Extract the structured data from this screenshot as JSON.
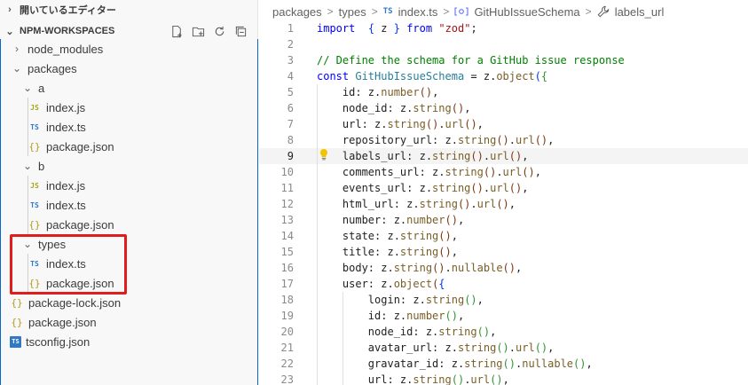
{
  "sidebar": {
    "open_editors_label": "開いているエディター",
    "workspace_label": "NPM-WORKSPACES",
    "tree": [
      {
        "label": "node_modules",
        "kind": "folder",
        "expanded": false,
        "depth": 0
      },
      {
        "label": "packages",
        "kind": "folder",
        "expanded": true,
        "depth": 0
      },
      {
        "label": "a",
        "kind": "folder",
        "expanded": true,
        "depth": 1
      },
      {
        "label": "index.js",
        "kind": "js",
        "depth": 2
      },
      {
        "label": "index.ts",
        "kind": "ts",
        "depth": 2
      },
      {
        "label": "package.json",
        "kind": "json",
        "depth": 2
      },
      {
        "label": "b",
        "kind": "folder",
        "expanded": true,
        "depth": 1
      },
      {
        "label": "index.js",
        "kind": "js",
        "depth": 2
      },
      {
        "label": "index.ts",
        "kind": "ts",
        "depth": 2
      },
      {
        "label": "package.json",
        "kind": "json",
        "depth": 2
      },
      {
        "label": "types",
        "kind": "folder",
        "expanded": true,
        "depth": 1
      },
      {
        "label": "index.ts",
        "kind": "ts",
        "depth": 2
      },
      {
        "label": "package.json",
        "kind": "json",
        "depth": 2
      },
      {
        "label": "package-lock.json",
        "kind": "json",
        "depth": 0
      },
      {
        "label": "package.json",
        "kind": "json",
        "depth": 0
      },
      {
        "label": "tsconfig.json",
        "kind": "tsconfig",
        "depth": 0
      }
    ],
    "icons": {
      "js": "JS",
      "ts": "TS",
      "json": "{}",
      "tsconfig": "TS"
    }
  },
  "breadcrumb": {
    "items": [
      "packages",
      "types",
      "index.ts",
      "GitHubIssueSchema",
      "labels_url"
    ],
    "separator": ">"
  },
  "editor": {
    "active_line": 9,
    "lines": [
      {
        "n": "1",
        "tokens": [
          [
            "kw",
            "import"
          ],
          [
            "",
            "  "
          ],
          [
            "br1",
            "{"
          ],
          [
            "",
            " z "
          ],
          [
            "br1",
            "}"
          ],
          [
            "",
            " "
          ],
          [
            "kw",
            "from"
          ],
          [
            "",
            " "
          ],
          [
            "str",
            "\"zod\""
          ],
          [
            "",
            ";"
          ]
        ]
      },
      {
        "n": "2",
        "tokens": []
      },
      {
        "n": "3",
        "tokens": [
          [
            "cm",
            "// Define the schema for a GitHub issue response"
          ]
        ]
      },
      {
        "n": "4",
        "tokens": [
          [
            "kw",
            "const"
          ],
          [
            "",
            " "
          ],
          [
            "type",
            "GitHubIssueSchema"
          ],
          [
            "",
            " = z."
          ],
          [
            "fn",
            "object"
          ],
          [
            "br1",
            "("
          ],
          [
            "br2",
            "{"
          ]
        ]
      },
      {
        "n": "5",
        "tokens": [
          [
            "",
            "    id: z."
          ],
          [
            "fn",
            "number"
          ],
          [
            "br3",
            "()"
          ],
          [
            "",
            ","
          ]
        ]
      },
      {
        "n": "6",
        "tokens": [
          [
            "",
            "    node_id: z."
          ],
          [
            "fn",
            "string"
          ],
          [
            "br3",
            "()"
          ],
          [
            "",
            ","
          ]
        ]
      },
      {
        "n": "7",
        "tokens": [
          [
            "",
            "    url: z."
          ],
          [
            "fn",
            "string"
          ],
          [
            "br3",
            "()"
          ],
          [
            "",
            "."
          ],
          [
            "fn",
            "url"
          ],
          [
            "br3",
            "()"
          ],
          [
            "",
            ","
          ]
        ]
      },
      {
        "n": "8",
        "tokens": [
          [
            "",
            "    repository_url: z."
          ],
          [
            "fn",
            "string"
          ],
          [
            "br3",
            "()"
          ],
          [
            "",
            "."
          ],
          [
            "fn",
            "url"
          ],
          [
            "br3",
            "()"
          ],
          [
            "",
            ","
          ]
        ]
      },
      {
        "n": "9",
        "tokens": [
          [
            "",
            "    labels_url: z."
          ],
          [
            "fn",
            "string"
          ],
          [
            "br3",
            "()"
          ],
          [
            "",
            "."
          ],
          [
            "fn",
            "url"
          ],
          [
            "br3",
            "()"
          ],
          [
            "",
            ","
          ]
        ]
      },
      {
        "n": "10",
        "tokens": [
          [
            "",
            "    comments_url: z."
          ],
          [
            "fn",
            "string"
          ],
          [
            "br3",
            "()"
          ],
          [
            "",
            "."
          ],
          [
            "fn",
            "url"
          ],
          [
            "br3",
            "()"
          ],
          [
            "",
            ","
          ]
        ]
      },
      {
        "n": "11",
        "tokens": [
          [
            "",
            "    events_url: z."
          ],
          [
            "fn",
            "string"
          ],
          [
            "br3",
            "()"
          ],
          [
            "",
            "."
          ],
          [
            "fn",
            "url"
          ],
          [
            "br3",
            "()"
          ],
          [
            "",
            ","
          ]
        ]
      },
      {
        "n": "12",
        "tokens": [
          [
            "",
            "    html_url: z."
          ],
          [
            "fn",
            "string"
          ],
          [
            "br3",
            "()"
          ],
          [
            "",
            "."
          ],
          [
            "fn",
            "url"
          ],
          [
            "br3",
            "()"
          ],
          [
            "",
            ","
          ]
        ]
      },
      {
        "n": "13",
        "tokens": [
          [
            "",
            "    number: z."
          ],
          [
            "fn",
            "number"
          ],
          [
            "br3",
            "()"
          ],
          [
            "",
            ","
          ]
        ]
      },
      {
        "n": "14",
        "tokens": [
          [
            "",
            "    state: z."
          ],
          [
            "fn",
            "string"
          ],
          [
            "br3",
            "()"
          ],
          [
            "",
            ","
          ]
        ]
      },
      {
        "n": "15",
        "tokens": [
          [
            "",
            "    title: z."
          ],
          [
            "fn",
            "string"
          ],
          [
            "br3",
            "()"
          ],
          [
            "",
            ","
          ]
        ]
      },
      {
        "n": "16",
        "tokens": [
          [
            "",
            "    body: z."
          ],
          [
            "fn",
            "string"
          ],
          [
            "br3",
            "()"
          ],
          [
            "",
            "."
          ],
          [
            "fn",
            "nullable"
          ],
          [
            "br3",
            "()"
          ],
          [
            "",
            ","
          ]
        ]
      },
      {
        "n": "17",
        "tokens": [
          [
            "",
            "    user: z."
          ],
          [
            "fn",
            "object"
          ],
          [
            "br3",
            "("
          ],
          [
            "br1",
            "{"
          ]
        ]
      },
      {
        "n": "18",
        "tokens": [
          [
            "",
            "        login: z."
          ],
          [
            "fn",
            "string"
          ],
          [
            "br2",
            "()"
          ],
          [
            "",
            ","
          ]
        ]
      },
      {
        "n": "19",
        "tokens": [
          [
            "",
            "        id: z."
          ],
          [
            "fn",
            "number"
          ],
          [
            "br2",
            "()"
          ],
          [
            "",
            ","
          ]
        ]
      },
      {
        "n": "20",
        "tokens": [
          [
            "",
            "        node_id: z."
          ],
          [
            "fn",
            "string"
          ],
          [
            "br2",
            "()"
          ],
          [
            "",
            ","
          ]
        ]
      },
      {
        "n": "21",
        "tokens": [
          [
            "",
            "        avatar_url: z."
          ],
          [
            "fn",
            "string"
          ],
          [
            "br2",
            "()"
          ],
          [
            "",
            "."
          ],
          [
            "fn",
            "url"
          ],
          [
            "br2",
            "()"
          ],
          [
            "",
            ","
          ]
        ]
      },
      {
        "n": "22",
        "tokens": [
          [
            "",
            "        gravatar_id: z."
          ],
          [
            "fn",
            "string"
          ],
          [
            "br2",
            "()"
          ],
          [
            "",
            "."
          ],
          [
            "fn",
            "nullable"
          ],
          [
            "br2",
            "()"
          ],
          [
            "",
            ","
          ]
        ]
      },
      {
        "n": "23",
        "tokens": [
          [
            "",
            "        url: z."
          ],
          [
            "fn",
            "string"
          ],
          [
            "br2",
            "()"
          ],
          [
            "",
            "."
          ],
          [
            "fn",
            "url"
          ],
          [
            "br2",
            "()"
          ],
          [
            "",
            ","
          ]
        ]
      }
    ]
  }
}
